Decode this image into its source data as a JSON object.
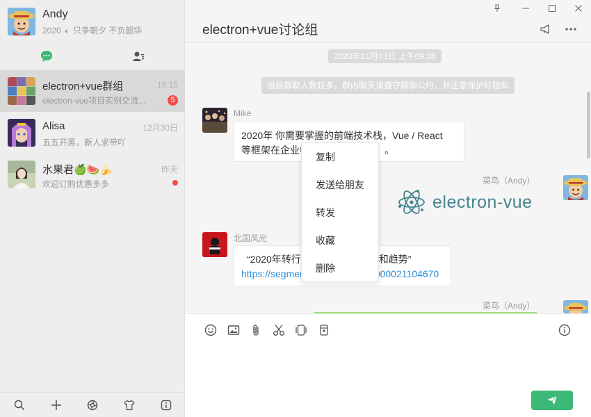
{
  "profile": {
    "name": "Andy",
    "sign_year": "2020",
    "sign_text": "只争朝夕 不负韶华"
  },
  "tabs": [
    {
      "icon": "chat-bubble-icon",
      "active": true
    },
    {
      "icon": "contacts-icon",
      "active": false
    }
  ],
  "conversations": [
    {
      "title": "electron+vue群组",
      "preview": "electron-vue项目实例交流...",
      "time": "16:15",
      "badge": "5",
      "active": true
    },
    {
      "title": "Alisa",
      "preview": "五五开黑，新人求带吖",
      "time": "12月30日"
    },
    {
      "title": "水果君🍏🍉🍌",
      "preview": "欢迎订购优惠多多",
      "time": "昨天",
      "unread_dot": true
    }
  ],
  "sidebar_footer": [
    "search-icon",
    "plus-icon",
    "aperture-icon",
    "tshirt-icon",
    "info-icon"
  ],
  "chat": {
    "title": "electron+vue讨论组",
    "time_divider": "2020年01月03日 上午09:38",
    "notice": "当前群聊人数较多，群内聊天请遵守群聊公约，并注意保护好隐私",
    "messages": [
      {
        "sender": "Mike",
        "text_line1": "2020年 你需要掌握的前端技术栈，Vue / React",
        "text_line2": "等框架在企业中",
        "text_tail": "。"
      },
      {
        "sender": "菜鸟（Andy）",
        "logo_text": "electron-vue"
      },
      {
        "sender": "北国风光",
        "text_line1_start": "“2020年转行",
        "text_line1_end": "端和趋势”",
        "link_start": "https://segmen",
        "link_end": "000021104670"
      },
      {
        "sender": "菜鸟（Andy）"
      }
    ]
  },
  "context_menu": [
    "复制",
    "发送给朋友",
    "转发",
    "收藏",
    "删除"
  ],
  "composer": {
    "tools": [
      "emoji-icon",
      "image-icon",
      "attachment-icon",
      "scissors-icon",
      "video-icon",
      "cup-icon",
      "info-icon"
    ]
  },
  "colors": {
    "accent_green": "#3db877",
    "badge_red": "#f24b4b",
    "link_blue": "#2f8fd8",
    "logo_teal": "#47848f"
  }
}
